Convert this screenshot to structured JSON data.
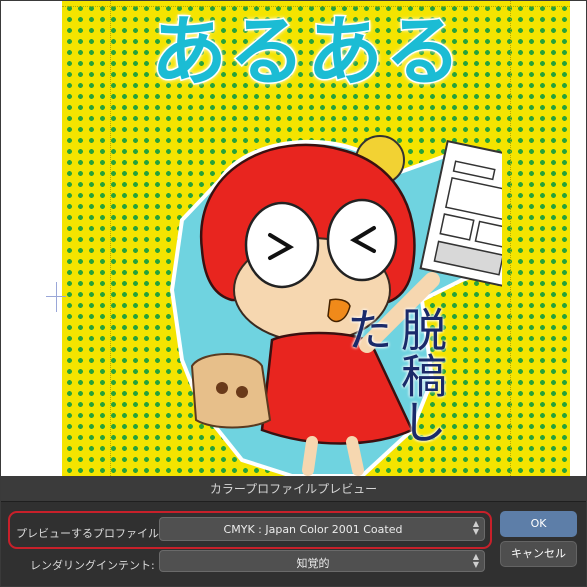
{
  "artwork": {
    "title": "あるある",
    "caption": "脱稿した"
  },
  "dialog": {
    "title": "カラープロファイルプレビュー",
    "preview_profile_label": "プレビューするプロファイル:",
    "preview_profile_value": "CMYK : Japan Color 2001 Coated",
    "rendering_intent_label": "レンダリングインテント:",
    "rendering_intent_value": "知覚的",
    "ok_label": "OK",
    "cancel_label": "キャンセル"
  },
  "colors": {
    "background_yellow": "#f4e400",
    "dot_green": "#27a23a",
    "title_cyan": "#1bbcd4",
    "highlight_red": "#c8202a",
    "ok_blue": "#5d7ea8"
  },
  "icons": [
    "up-down-arrows-icon",
    "crosshair-icon"
  ]
}
